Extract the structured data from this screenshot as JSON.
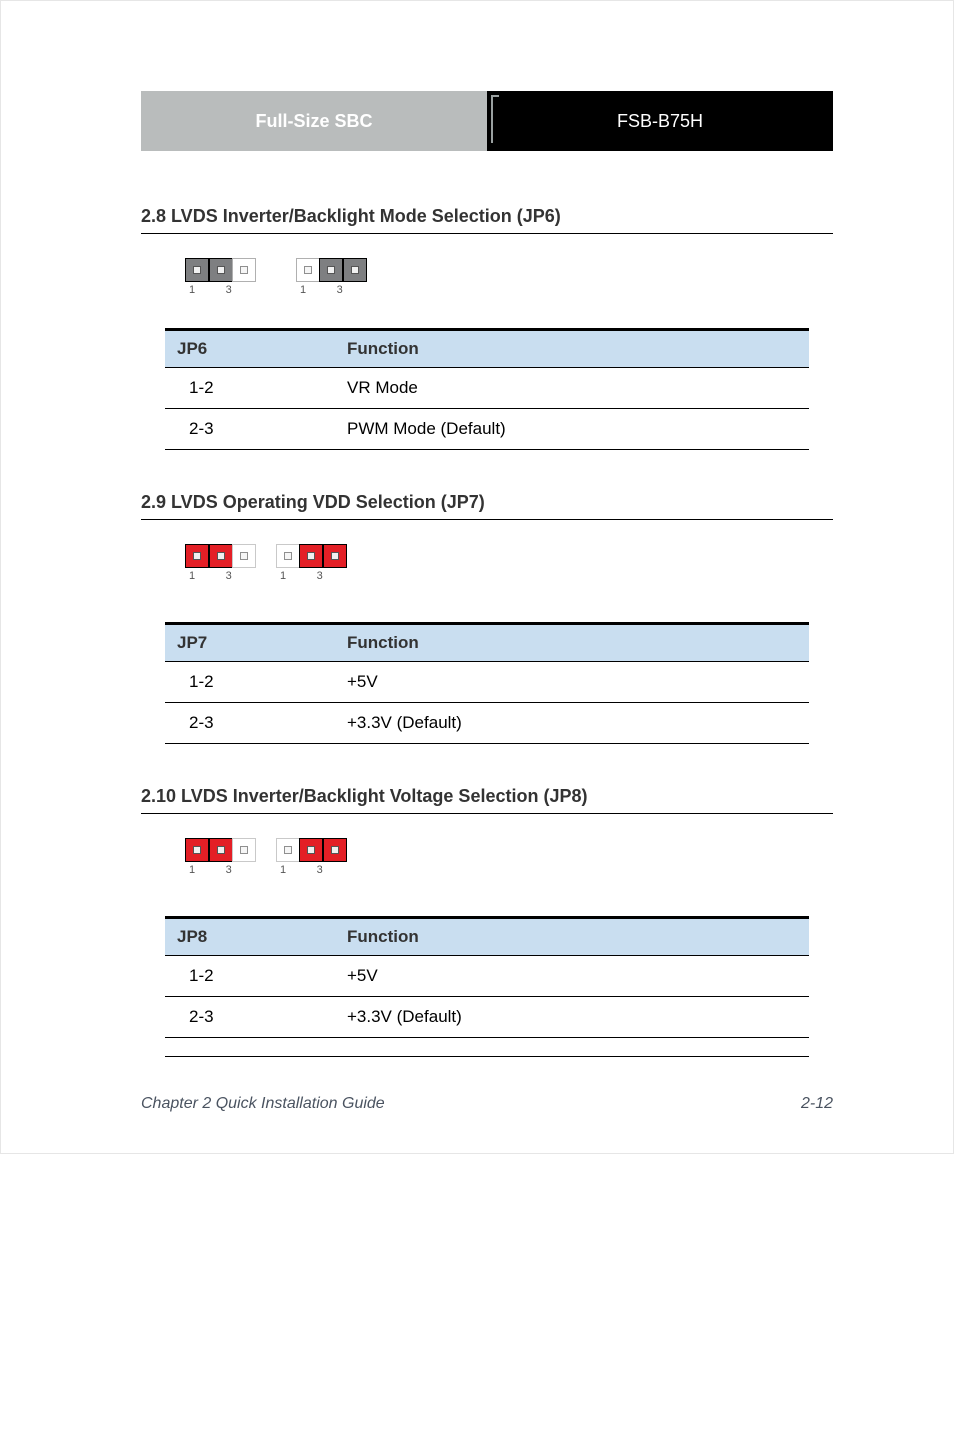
{
  "header": {
    "left": "Full-Size SBC",
    "right": "FSB-B75H"
  },
  "sections": [
    {
      "id": "s1",
      "title": "2.8 LVDS Inverter/Backlight Mode Selection (JP6)",
      "jumper_color": "gray",
      "label_left": "1          3",
      "label_right": "1          3",
      "table": {
        "hcol1": "JP6",
        "hcol2": "Function",
        "rows": [
          {
            "pin": "1-2",
            "func": "VR Mode"
          },
          {
            "pin": "2-3",
            "func": "PWM Mode (Default)"
          }
        ]
      }
    },
    {
      "id": "s2",
      "title": "2.9 LVDS Operating VDD Selection (JP7)",
      "jumper_color": "red",
      "label_left": "1          3",
      "label_right": "1          3",
      "table": {
        "hcol1": "JP7",
        "hcol2": "Function",
        "rows": [
          {
            "pin": "1-2",
            "func": "+5V"
          },
          {
            "pin": "2-3",
            "func": "+3.3V (Default)"
          }
        ]
      }
    },
    {
      "id": "s3",
      "title": "2.10 LVDS Inverter/Backlight Voltage Selection (JP8)",
      "jumper_color": "red",
      "label_left": "1          3",
      "label_right": "1          3",
      "table": {
        "hcol1": "JP8",
        "hcol2": "Function",
        "rows": [
          {
            "pin": "1-2",
            "func": "+5V"
          },
          {
            "pin": "2-3",
            "func": "+3.3V (Default)"
          }
        ]
      }
    }
  ],
  "footer": {
    "chapter": "Chapter 2 Quick Installation Guide",
    "page": "2-12"
  }
}
